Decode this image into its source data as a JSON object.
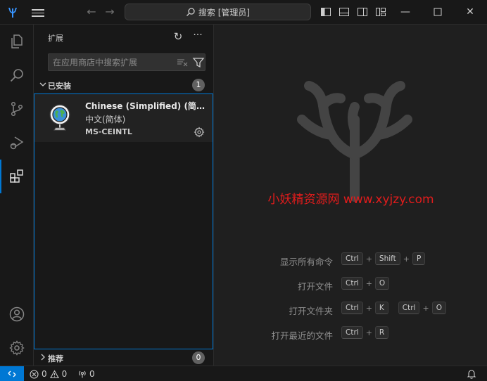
{
  "titlebar": {
    "search_label": "搜索 [管理员]",
    "back_arrow": "←",
    "forward_arrow": "→",
    "minimize": "—",
    "close": "✕"
  },
  "activity_bar": {
    "items": [
      "explorer-icon",
      "search-icon",
      "source-control-icon",
      "run-debug-icon",
      "extensions-icon"
    ],
    "bottom": [
      "accounts-icon",
      "manage-gear-icon"
    ],
    "accent": "#0078d4"
  },
  "sidebar": {
    "title": "扩展",
    "refresh_glyph": "↻",
    "more_glyph": "···",
    "search_placeholder": "在应用商店中搜索扩展",
    "installed": {
      "label": "已安装",
      "count": "1",
      "items": [
        {
          "name": "Chinese (Simplified) (简体中文) Language Pack for Visual Studio Code",
          "description": "中文(简体)",
          "publisher": "MS-CEINTL"
        }
      ]
    },
    "recommended": {
      "label": "推荐",
      "count": "0"
    }
  },
  "editor": {
    "watermark_text": "小妖精资源网 www.xyjzy.com",
    "watermark_color": "#e21c1c",
    "shortcuts": [
      {
        "label": "显示所有命令",
        "keys": [
          "Ctrl",
          "Shift",
          "P"
        ]
      },
      {
        "label": "打开文件",
        "keys": [
          "Ctrl",
          "O"
        ]
      },
      {
        "label": "打开文件夹",
        "keys": [
          "Ctrl",
          "K"
        ],
        "keys2": [
          "Ctrl",
          "O"
        ]
      },
      {
        "label": "打开最近的文件",
        "keys": [
          "Ctrl",
          "R"
        ]
      }
    ]
  },
  "statusbar": {
    "errors": "0",
    "warnings": "0",
    "ports": "0"
  }
}
